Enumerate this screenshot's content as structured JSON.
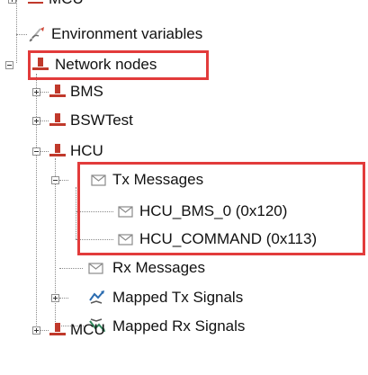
{
  "tree": {
    "mcu_top": "MCU",
    "environment_variables": "Environment variables",
    "network_nodes": "Network nodes",
    "bms": "BMS",
    "bswtest": "BSWTest",
    "hcu": "HCU",
    "tx_messages": "Tx Messages",
    "hcu_bms_0": "HCU_BMS_0 (0x120)",
    "hcu_command": "HCU_COMMAND (0x113)",
    "rx_messages": "Rx Messages",
    "mapped_tx_signals": "Mapped Tx Signals",
    "mapped_rx_signals": "Mapped Rx Signals",
    "mcu_bottom": "MCU"
  },
  "colors": {
    "highlight": "#e23b3b",
    "node_icon": "#c0392b",
    "tree_lines": "#8a8a8a"
  },
  "icons": {
    "environment_variables": "pencil-icon",
    "network_node": "network-node-icon",
    "message": "envelope-icon",
    "mapped_tx": "mapped-tx-signals-icon",
    "mapped_rx": "mapped-rx-signals-icon"
  }
}
